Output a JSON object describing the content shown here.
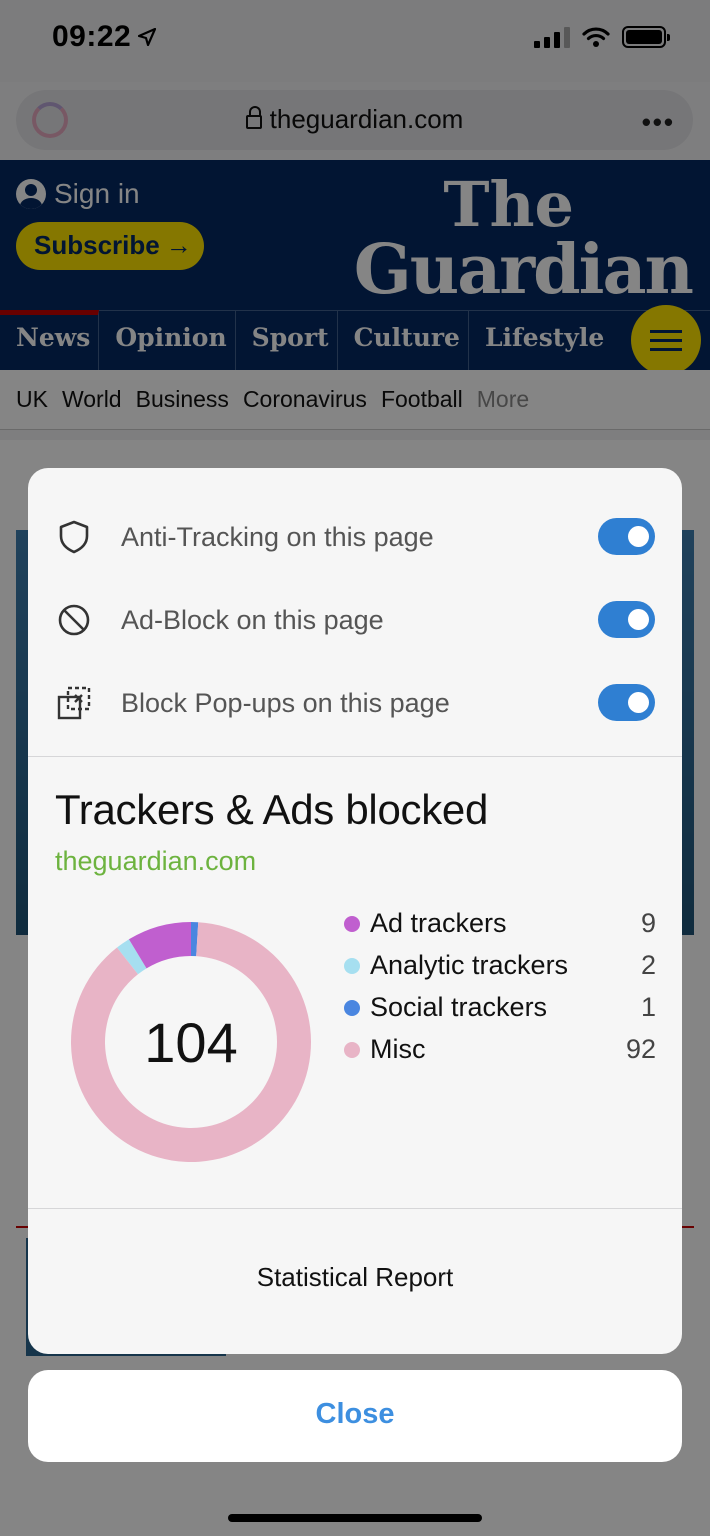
{
  "status_bar": {
    "time": "09:22"
  },
  "browser": {
    "url": "theguardian.com"
  },
  "site": {
    "sign_in": "Sign in",
    "subscribe": "Subscribe",
    "subscribe_arrow": "→",
    "logo_line1": "The",
    "logo_line2": "Guardian",
    "pillars": [
      "News",
      "Opinion",
      "Sport",
      "Culture",
      "Lifestyle"
    ],
    "subnav": [
      "UK",
      "World",
      "Business",
      "Coronavirus",
      "Football",
      "More"
    ]
  },
  "popup": {
    "settings": [
      {
        "label": "Anti-Tracking on this page",
        "icon": "shield-icon",
        "enabled": true
      },
      {
        "label": "Ad-Block on this page",
        "icon": "block-icon",
        "enabled": true
      },
      {
        "label": "Block Pop-ups on this page",
        "icon": "popup-block-icon",
        "enabled": true
      }
    ],
    "title": "Trackers & Ads blocked",
    "domain": "theguardian.com",
    "total": "104",
    "report_label": "Statistical Report",
    "close_label": "Close"
  },
  "colors": {
    "toggle_on": "#2f7fd2",
    "domain_green": "#6db33f",
    "close_blue": "#3d8fe0"
  },
  "chart_data": {
    "type": "pie",
    "center_label": "104",
    "categories": [
      "Ad trackers",
      "Analytic trackers",
      "Social trackers",
      "Misc"
    ],
    "values": [
      9,
      2,
      1,
      92
    ],
    "colors": [
      "#c05fcf",
      "#a6dff0",
      "#4a86e0",
      "#e8b4c6"
    ]
  }
}
